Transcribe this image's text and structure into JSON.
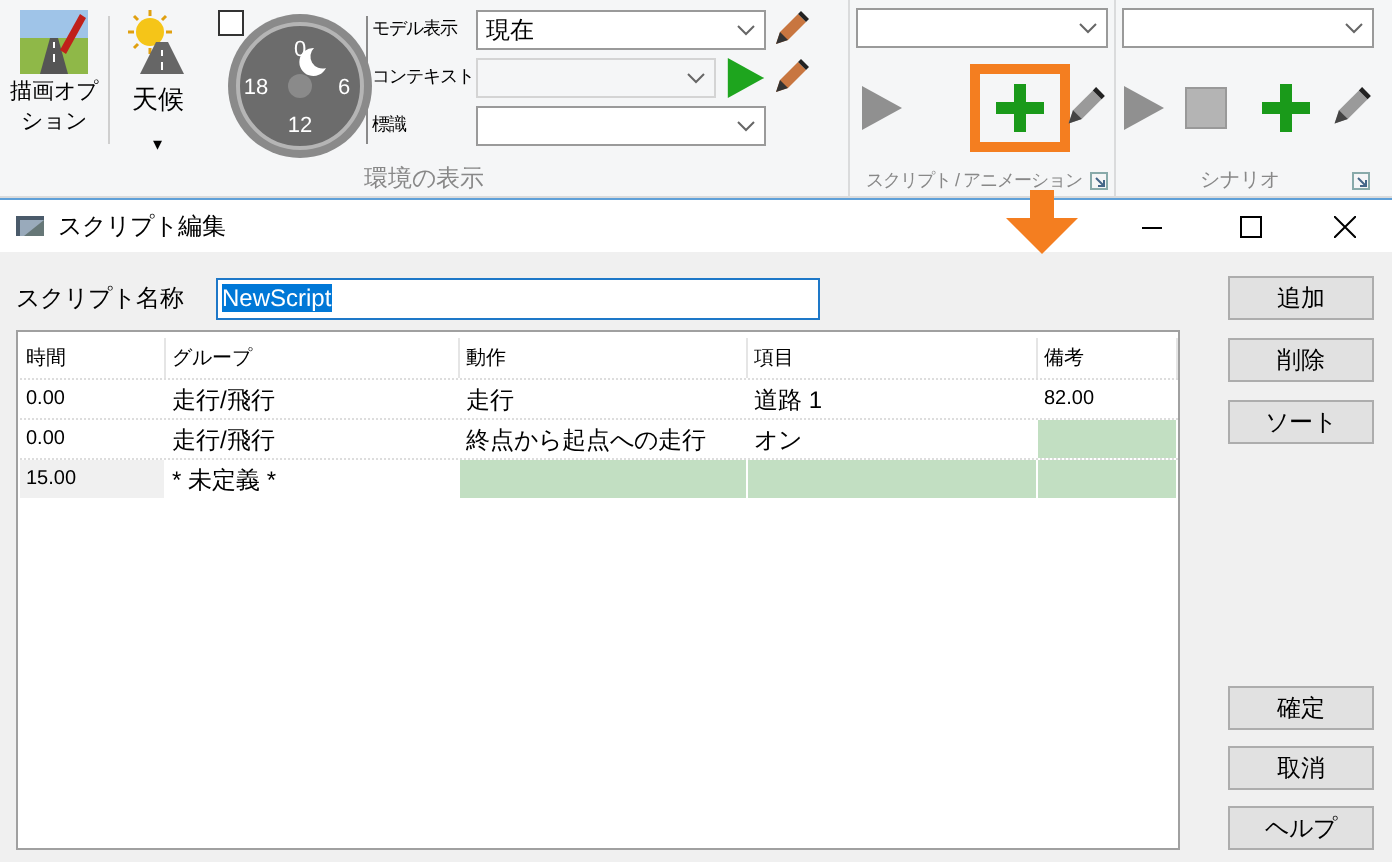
{
  "ribbon": {
    "draw_options": {
      "label": "描画オプション"
    },
    "weather": {
      "label": "天候",
      "caret": "▾"
    },
    "time_checkbox": {
      "checked": false
    },
    "clock": {
      "marks": [
        "0",
        "6",
        "12",
        "18"
      ]
    },
    "fields": [
      {
        "label": "モデル表示",
        "value": "現在",
        "disabled": false
      },
      {
        "label": "コンテキスト",
        "disabled": true
      },
      {
        "label": "標識",
        "disabled": false
      }
    ],
    "env_group_label": "環境の表示",
    "script_group": {
      "label": "スクリプト / アニメーション",
      "add_highlighted": true
    },
    "scenario_group": {
      "label": "シナリオ"
    }
  },
  "dialog": {
    "title": "スクリプト編集",
    "name_label": "スクリプト名称",
    "name_value": "NewScript",
    "table": {
      "columns": [
        "時間",
        "グループ",
        "動作",
        "項目",
        "備考"
      ],
      "rows": [
        {
          "current": false,
          "cells": [
            {
              "text": "0.00",
              "highlighted": false
            },
            {
              "text": "走行/飛行",
              "highlighted": false
            },
            {
              "text": "走行",
              "highlighted": false
            },
            {
              "text": "道路 1",
              "highlighted": false
            },
            {
              "text": "82.00",
              "highlighted": false
            }
          ]
        },
        {
          "current": false,
          "cells": [
            {
              "text": "0.00",
              "highlighted": false
            },
            {
              "text": "走行/飛行",
              "highlighted": false
            },
            {
              "text": "終点から起点への走行",
              "highlighted": false
            },
            {
              "text": "オン",
              "highlighted": false
            },
            {
              "text": "",
              "highlighted": true
            }
          ]
        },
        {
          "current": true,
          "cells": [
            {
              "text": "15.00",
              "highlighted": false
            },
            {
              "text": "* 未定義 *",
              "highlighted": false
            },
            {
              "text": "",
              "highlighted": true
            },
            {
              "text": "",
              "highlighted": true
            },
            {
              "text": "",
              "highlighted": true
            }
          ]
        }
      ]
    },
    "top_buttons": [
      "追加",
      "削除",
      "ソート"
    ],
    "bottom_buttons": [
      "確定",
      "取消",
      "ヘルプ"
    ]
  }
}
